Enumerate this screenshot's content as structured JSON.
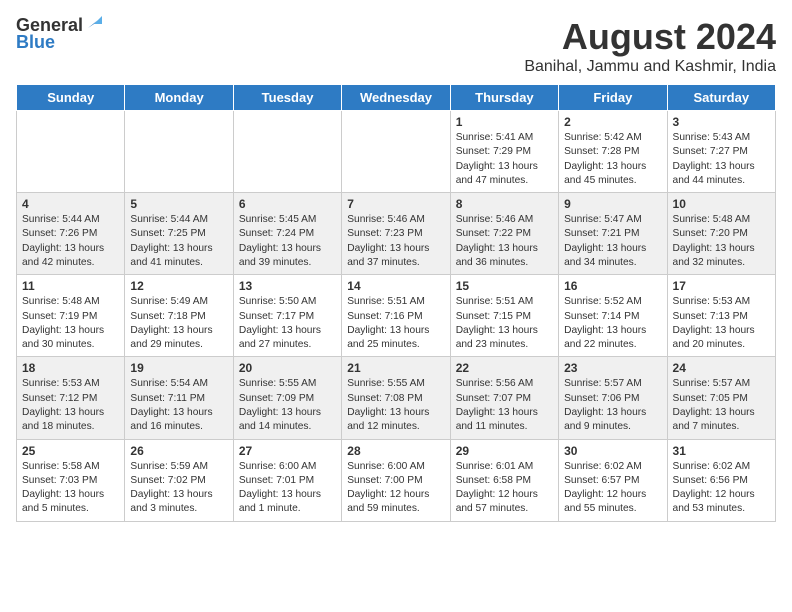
{
  "header": {
    "logo_general": "General",
    "logo_blue": "Blue",
    "main_title": "August 2024",
    "subtitle": "Banihal, Jammu and Kashmir, India"
  },
  "weekdays": [
    "Sunday",
    "Monday",
    "Tuesday",
    "Wednesday",
    "Thursday",
    "Friday",
    "Saturday"
  ],
  "weeks": [
    [
      {
        "day": "",
        "content": ""
      },
      {
        "day": "",
        "content": ""
      },
      {
        "day": "",
        "content": ""
      },
      {
        "day": "",
        "content": ""
      },
      {
        "day": "1",
        "content": "Sunrise: 5:41 AM\nSunset: 7:29 PM\nDaylight: 13 hours and 47 minutes."
      },
      {
        "day": "2",
        "content": "Sunrise: 5:42 AM\nSunset: 7:28 PM\nDaylight: 13 hours and 45 minutes."
      },
      {
        "day": "3",
        "content": "Sunrise: 5:43 AM\nSunset: 7:27 PM\nDaylight: 13 hours and 44 minutes."
      }
    ],
    [
      {
        "day": "4",
        "content": "Sunrise: 5:44 AM\nSunset: 7:26 PM\nDaylight: 13 hours and 42 minutes."
      },
      {
        "day": "5",
        "content": "Sunrise: 5:44 AM\nSunset: 7:25 PM\nDaylight: 13 hours and 41 minutes."
      },
      {
        "day": "6",
        "content": "Sunrise: 5:45 AM\nSunset: 7:24 PM\nDaylight: 13 hours and 39 minutes."
      },
      {
        "day": "7",
        "content": "Sunrise: 5:46 AM\nSunset: 7:23 PM\nDaylight: 13 hours and 37 minutes."
      },
      {
        "day": "8",
        "content": "Sunrise: 5:46 AM\nSunset: 7:22 PM\nDaylight: 13 hours and 36 minutes."
      },
      {
        "day": "9",
        "content": "Sunrise: 5:47 AM\nSunset: 7:21 PM\nDaylight: 13 hours and 34 minutes."
      },
      {
        "day": "10",
        "content": "Sunrise: 5:48 AM\nSunset: 7:20 PM\nDaylight: 13 hours and 32 minutes."
      }
    ],
    [
      {
        "day": "11",
        "content": "Sunrise: 5:48 AM\nSunset: 7:19 PM\nDaylight: 13 hours and 30 minutes."
      },
      {
        "day": "12",
        "content": "Sunrise: 5:49 AM\nSunset: 7:18 PM\nDaylight: 13 hours and 29 minutes."
      },
      {
        "day": "13",
        "content": "Sunrise: 5:50 AM\nSunset: 7:17 PM\nDaylight: 13 hours and 27 minutes."
      },
      {
        "day": "14",
        "content": "Sunrise: 5:51 AM\nSunset: 7:16 PM\nDaylight: 13 hours and 25 minutes."
      },
      {
        "day": "15",
        "content": "Sunrise: 5:51 AM\nSunset: 7:15 PM\nDaylight: 13 hours and 23 minutes."
      },
      {
        "day": "16",
        "content": "Sunrise: 5:52 AM\nSunset: 7:14 PM\nDaylight: 13 hours and 22 minutes."
      },
      {
        "day": "17",
        "content": "Sunrise: 5:53 AM\nSunset: 7:13 PM\nDaylight: 13 hours and 20 minutes."
      }
    ],
    [
      {
        "day": "18",
        "content": "Sunrise: 5:53 AM\nSunset: 7:12 PM\nDaylight: 13 hours and 18 minutes."
      },
      {
        "day": "19",
        "content": "Sunrise: 5:54 AM\nSunset: 7:11 PM\nDaylight: 13 hours and 16 minutes."
      },
      {
        "day": "20",
        "content": "Sunrise: 5:55 AM\nSunset: 7:09 PM\nDaylight: 13 hours and 14 minutes."
      },
      {
        "day": "21",
        "content": "Sunrise: 5:55 AM\nSunset: 7:08 PM\nDaylight: 13 hours and 12 minutes."
      },
      {
        "day": "22",
        "content": "Sunrise: 5:56 AM\nSunset: 7:07 PM\nDaylight: 13 hours and 11 minutes."
      },
      {
        "day": "23",
        "content": "Sunrise: 5:57 AM\nSunset: 7:06 PM\nDaylight: 13 hours and 9 minutes."
      },
      {
        "day": "24",
        "content": "Sunrise: 5:57 AM\nSunset: 7:05 PM\nDaylight: 13 hours and 7 minutes."
      }
    ],
    [
      {
        "day": "25",
        "content": "Sunrise: 5:58 AM\nSunset: 7:03 PM\nDaylight: 13 hours and 5 minutes."
      },
      {
        "day": "26",
        "content": "Sunrise: 5:59 AM\nSunset: 7:02 PM\nDaylight: 13 hours and 3 minutes."
      },
      {
        "day": "27",
        "content": "Sunrise: 6:00 AM\nSunset: 7:01 PM\nDaylight: 13 hours and 1 minute."
      },
      {
        "day": "28",
        "content": "Sunrise: 6:00 AM\nSunset: 7:00 PM\nDaylight: 12 hours and 59 minutes."
      },
      {
        "day": "29",
        "content": "Sunrise: 6:01 AM\nSunset: 6:58 PM\nDaylight: 12 hours and 57 minutes."
      },
      {
        "day": "30",
        "content": "Sunrise: 6:02 AM\nSunset: 6:57 PM\nDaylight: 12 hours and 55 minutes."
      },
      {
        "day": "31",
        "content": "Sunrise: 6:02 AM\nSunset: 6:56 PM\nDaylight: 12 hours and 53 minutes."
      }
    ]
  ]
}
